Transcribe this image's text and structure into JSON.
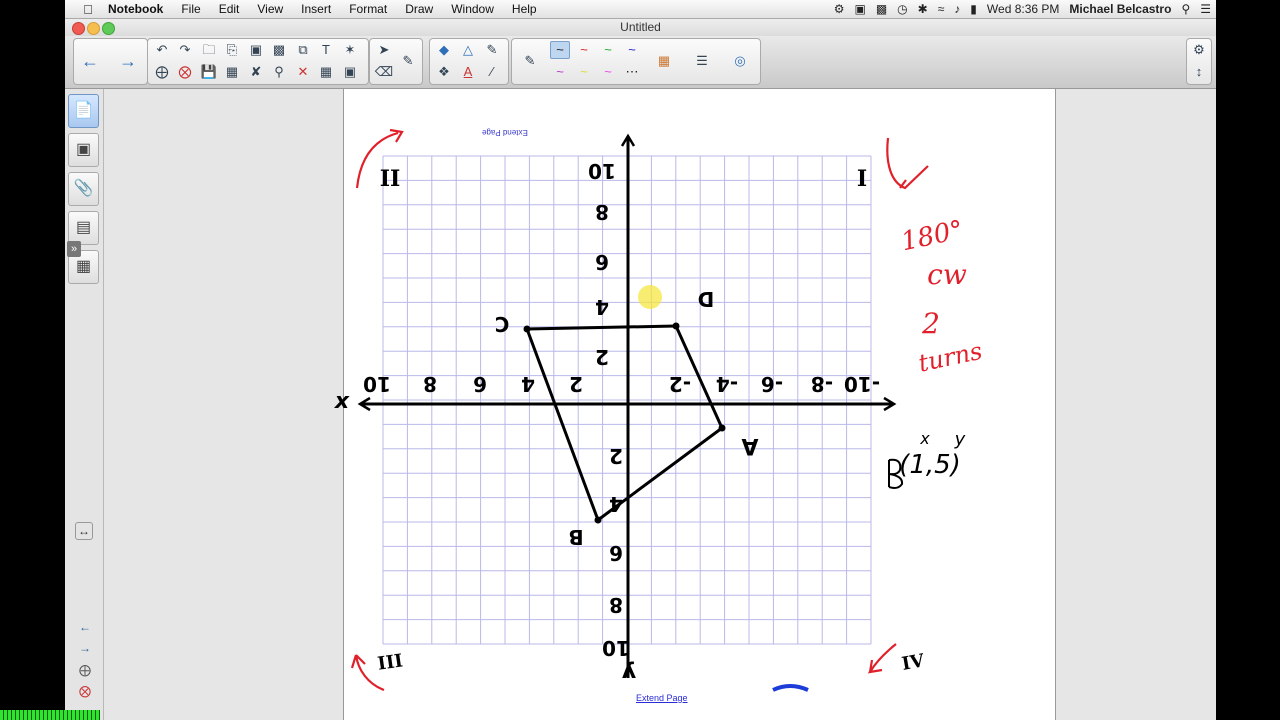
{
  "menubar": {
    "apple": "",
    "items": [
      "Notebook",
      "File",
      "Edit",
      "View",
      "Insert",
      "Format",
      "Draw",
      "Window",
      "Help"
    ],
    "clock": "Wed 8:36 PM",
    "user": "Michael Belcastro"
  },
  "window": {
    "title": "Untitled"
  },
  "page": {
    "extend_label_top": "Extend Page",
    "extend_label_bottom": "Extend Page"
  },
  "graph": {
    "y_labels_top": [
      "10",
      "8",
      "6",
      "4",
      "2"
    ],
    "y_labels_bottom": [
      "2",
      "4",
      "6",
      "8",
      "10"
    ],
    "x_labels_left": [
      "10",
      "8",
      "6",
      "4",
      "2"
    ],
    "x_labels_right": [
      "2",
      "4",
      "6",
      "8",
      "10"
    ],
    "x_axis_letter": "x",
    "y_axis_letter": "y",
    "points": {
      "A": "A",
      "B": "B",
      "C": "C",
      "D": "D"
    },
    "quadrants": {
      "q1": "I",
      "q2": "II",
      "q3": "III",
      "q4": "IV"
    }
  },
  "annotations": {
    "rotation": "180°",
    "direction": "cw",
    "turns_count": "2",
    "turns_word": "turns",
    "coord_point": "B",
    "coord_value": "(1,5)",
    "coord_x": "x",
    "coord_y": "y"
  },
  "colors": {
    "ink_red": "#e0202a",
    "grid": "#b8b8ea",
    "highlight": "#f5e642"
  }
}
